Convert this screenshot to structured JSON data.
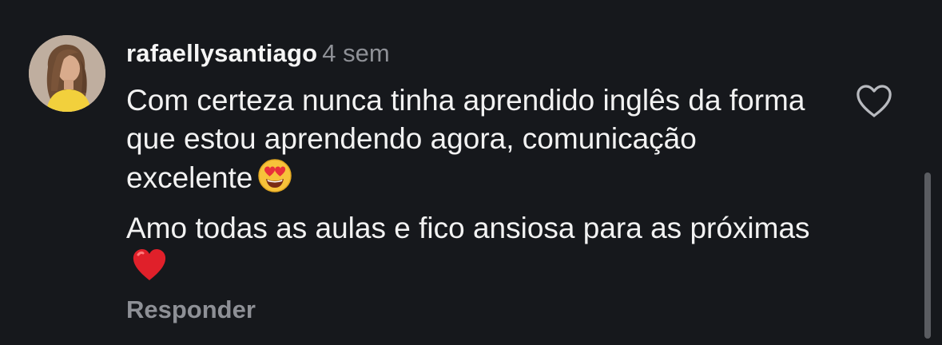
{
  "comment": {
    "username": "rafaellysantiago",
    "timestamp": "4 sem",
    "paragraph_1": "Com certeza nunca tinha aprendido inglês da forma que estou aprendendo agora, comunicação excelente",
    "paragraph_1_emoji": "heart-eyes-emoji",
    "paragraph_2": "Amo todas as aulas e fico ansiosa para as próximas",
    "paragraph_2_emoji": "red-heart-emoji",
    "reply_label": "Responder",
    "like_icon": "heart-outline-icon"
  },
  "colors": {
    "background": "#16181c",
    "text": "#f2f2f2",
    "muted": "#8e9096"
  }
}
